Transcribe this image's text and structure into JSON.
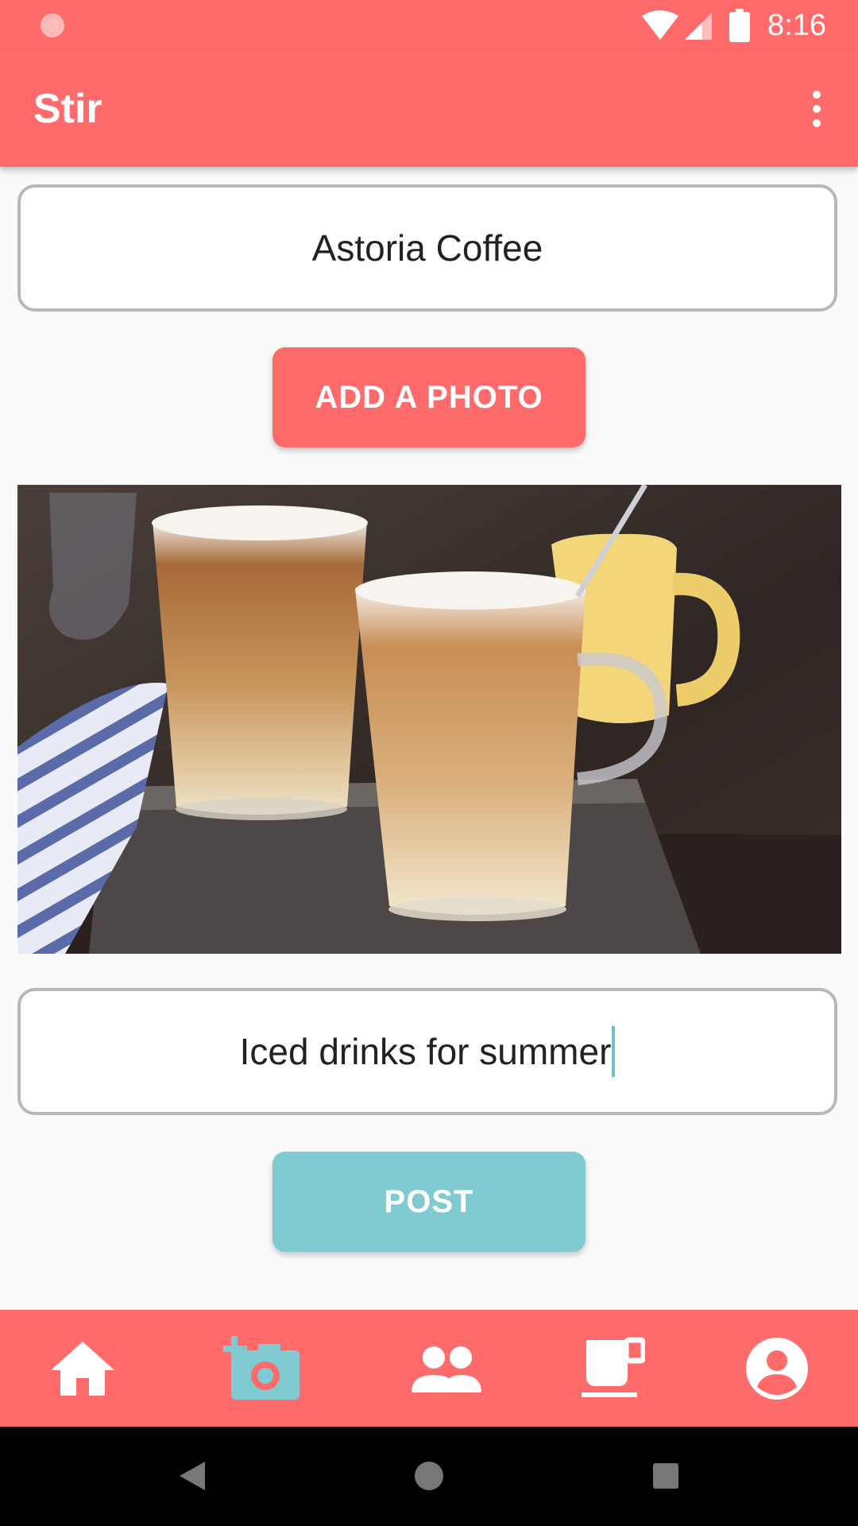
{
  "status_bar": {
    "time": "8:16",
    "icons": [
      "notification-icon",
      "wifi-icon",
      "cell-signal-icon",
      "battery-icon"
    ]
  },
  "app_bar": {
    "title": "Stir",
    "menu_icon": "more-vert-icon"
  },
  "form": {
    "location_value": "Astoria Coffee",
    "add_photo_label": "ADD A PHOTO",
    "caption_value": "Iced drinks for summer",
    "post_label": "POST"
  },
  "bottom_nav": {
    "items": [
      {
        "icon": "home-icon",
        "selected": false
      },
      {
        "icon": "add-photo-icon",
        "selected": true
      },
      {
        "icon": "people-icon",
        "selected": false
      },
      {
        "icon": "coffee-cup-icon",
        "selected": false
      },
      {
        "icon": "account-icon",
        "selected": false
      }
    ]
  },
  "system_nav": {
    "icons": [
      "back-icon",
      "home-circle-icon",
      "recents-icon"
    ]
  },
  "colors": {
    "primary": "#ff6b6b",
    "accent": "#80cbd1",
    "background": "#fafafa"
  }
}
